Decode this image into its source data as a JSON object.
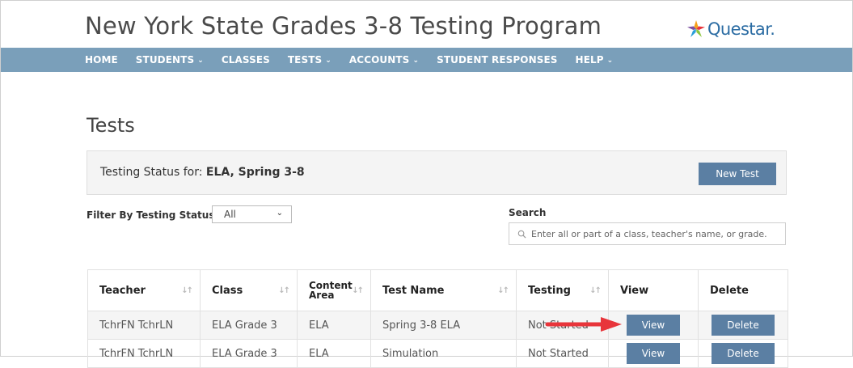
{
  "header": {
    "title": "New York State Grades 3-8 Testing Program",
    "brand": "Questar."
  },
  "nav": {
    "items": [
      {
        "label": "HOME",
        "caret": ""
      },
      {
        "label": "STUDENTS",
        "caret": "⌄"
      },
      {
        "label": "CLASSES",
        "caret": ""
      },
      {
        "label": "TESTS",
        "caret": "⌄"
      },
      {
        "label": "ACCOUNTS",
        "caret": "⌄"
      },
      {
        "label": "STUDENT RESPONSES",
        "caret": ""
      },
      {
        "label": "HELP",
        "caret": "⌄"
      }
    ]
  },
  "page": {
    "title": "Tests"
  },
  "status": {
    "label": "Testing Status for: ",
    "value": "ELA, Spring 3-8",
    "new_test_label": "New Test"
  },
  "filter": {
    "label": "Filter By Testing Status:",
    "selected": "All"
  },
  "search": {
    "label": "Search",
    "placeholder": "Enter all or part of a class, teacher's name, or grade."
  },
  "table": {
    "columns": {
      "teacher": "Teacher",
      "class": "Class",
      "content_area_1": "Content",
      "content_area_2": "Area",
      "test_name": "Test Name",
      "testing": "Testing",
      "view": "View",
      "delete": "Delete"
    },
    "rows": [
      {
        "teacher": "TchrFN TchrLN",
        "class": "ELA Grade 3",
        "content_area": "ELA",
        "test_name": "Spring 3-8 ELA",
        "testing": "Not Started",
        "view": "View",
        "delete": "Delete"
      },
      {
        "teacher": "TchrFN TchrLN",
        "class": "ELA Grade 3",
        "content_area": "ELA",
        "test_name": "Simulation",
        "testing": "Not Started",
        "view": "View",
        "delete": "Delete"
      }
    ]
  },
  "colors": {
    "navbar": "#7a9fba",
    "button": "#5b7fa3",
    "annotation_arrow": "#e8353b"
  },
  "icons": {
    "brand_logo": "questar-star-icon",
    "search": "search-icon",
    "sort": "sort-icon",
    "dropdown": "chevron-down-icon",
    "annotation": "arrow-right-icon"
  }
}
